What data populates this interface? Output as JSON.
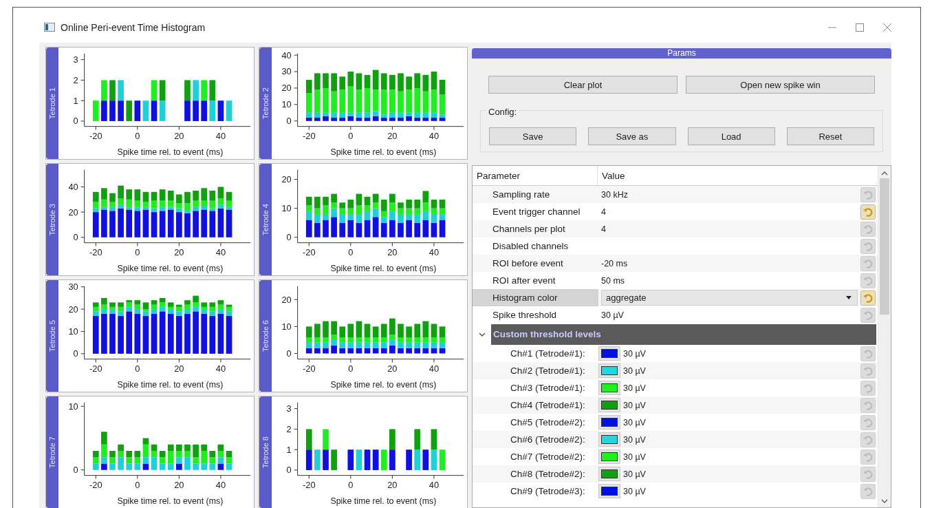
{
  "window": {
    "title": "Online Peri-event Time Histogram"
  },
  "plots": [
    {
      "chart_data": {
        "type": "bar",
        "stacked": true,
        "title": "Tetrode 1",
        "xlabel": "Spike time rel. to event (ms)",
        "x": [
          -20,
          -16,
          -12,
          -8,
          -4,
          0,
          4,
          8,
          12,
          16,
          20,
          24,
          28,
          32,
          36,
          40,
          44
        ],
        "xlim": [
          -25.5,
          54.3
        ],
        "ylim": [
          -0.26,
          3.3
        ],
        "xticks": [
          -20,
          0,
          20,
          40
        ],
        "yticks": [
          0,
          1,
          2,
          3
        ],
        "series": [
          {
            "color": "#1010e0",
            "values": [
              0,
              1,
              1,
              1,
              0,
              1,
              0,
              1,
              0,
              0,
              0,
              1,
              1,
              1,
              0,
              1,
              0
            ]
          },
          {
            "color": "#20d0d8",
            "values": [
              0,
              0,
              0,
              1,
              0,
              0,
              1,
              0,
              1,
              0,
              0,
              0,
              1,
              0,
              1,
              0,
              1
            ]
          },
          {
            "color": "#20ee20",
            "values": [
              1,
              1,
              0,
              0,
              0,
              0,
              0,
              1,
              0,
              0,
              0,
              0,
              0,
              1,
              0,
              0,
              0
            ]
          },
          {
            "color": "#10a010",
            "values": [
              0,
              0,
              1,
              0,
              1,
              0,
              0,
              0,
              1,
              0,
              0,
              1,
              0,
              0,
              1,
              0,
              0
            ]
          }
        ]
      }
    },
    {
      "chart_data": {
        "type": "bar",
        "stacked": true,
        "title": "Tetrode 2",
        "xlabel": "Spike time rel. to event (ms)",
        "x": [
          -20,
          -16,
          -12,
          -8,
          -4,
          0,
          4,
          8,
          12,
          16,
          20,
          24,
          28,
          32,
          36,
          40,
          44
        ],
        "xlim": [
          -25.5,
          54.3
        ],
        "ylim": [
          -3.3,
          41
        ],
        "xticks": [
          -20,
          0,
          20,
          40
        ],
        "yticks": [
          0,
          10,
          20,
          30,
          40
        ],
        "series": [
          {
            "color": "#1010e0",
            "values": [
              2,
              2,
              3,
              2,
              2,
              3,
              2,
              2,
              3,
              2,
              2,
              2,
              3,
              2,
              2,
              2,
              2
            ]
          },
          {
            "color": "#20d0d8",
            "values": [
              3,
              3,
              2,
              3,
              3,
              2,
              3,
              3,
              3,
              2,
              3,
              3,
              2,
              3,
              3,
              3,
              2
            ]
          },
          {
            "color": "#20ee20",
            "values": [
              12,
              14,
              15,
              13,
              14,
              16,
              14,
              15,
              13,
              15,
              14,
              13,
              14,
              15,
              13,
              14,
              12
            ]
          },
          {
            "color": "#10a010",
            "values": [
              8,
              10,
              9,
              11,
              8,
              9,
              10,
              8,
              12,
              10,
              9,
              11,
              8,
              9,
              10,
              11,
              9
            ]
          }
        ]
      }
    },
    {
      "chart_data": {
        "type": "bar",
        "stacked": true,
        "title": "Tetrode 3",
        "xlabel": "Spike time rel. to event (ms)",
        "x": [
          -20,
          -16,
          -12,
          -8,
          -4,
          0,
          4,
          8,
          12,
          16,
          20,
          24,
          28,
          32,
          36,
          40,
          44
        ],
        "xlim": [
          -25.5,
          54.3
        ],
        "ylim": [
          -4.3,
          53.5
        ],
        "xticks": [
          -20,
          0,
          20,
          40
        ],
        "yticks": [
          0,
          20,
          40
        ],
        "series": [
          {
            "color": "#1010e0",
            "values": [
              20,
              22,
              21,
              23,
              22,
              21,
              22,
              20,
              21,
              22,
              20,
              19,
              21,
              22,
              21,
              23,
              22
            ]
          },
          {
            "color": "#20d0d8",
            "values": [
              3,
              2,
              3,
              3,
              2,
              3,
              2,
              3,
              3,
              2,
              3,
              2,
              3,
              3,
              2,
              3,
              2
            ]
          },
          {
            "color": "#20ee20",
            "values": [
              5,
              6,
              4,
              5,
              6,
              5,
              4,
              6,
              5,
              5,
              4,
              6,
              5,
              4,
              6,
              5,
              5
            ]
          },
          {
            "color": "#10a010",
            "values": [
              8,
              9,
              7,
              10,
              8,
              9,
              8,
              7,
              9,
              8,
              7,
              9,
              8,
              10,
              8,
              9,
              7
            ]
          }
        ]
      }
    },
    {
      "chart_data": {
        "type": "bar",
        "stacked": true,
        "title": "Tetrode 4",
        "xlabel": "Spike time rel. to event (ms)",
        "x": [
          -20,
          -16,
          -12,
          -8,
          -4,
          0,
          4,
          8,
          12,
          16,
          20,
          24,
          28,
          32,
          36,
          40,
          44
        ],
        "xlim": [
          -25.5,
          54.3
        ],
        "ylim": [
          -1.9,
          23.3
        ],
        "xticks": [
          -20,
          0,
          20,
          40
        ],
        "yticks": [
          0,
          10,
          20
        ],
        "series": [
          {
            "color": "#1010e0",
            "values": [
              6,
              5,
              6,
              7,
              5,
              6,
              5,
              6,
              7,
              5,
              6,
              5,
              6,
              5,
              6,
              5,
              6
            ]
          },
          {
            "color": "#20d0d8",
            "values": [
              3,
              3,
              2,
              3,
              3,
              2,
              3,
              3,
              3,
              2,
              3,
              3,
              2,
              3,
              3,
              3,
              2
            ]
          },
          {
            "color": "#20ee20",
            "values": [
              2,
              2,
              3,
              2,
              2,
              2,
              3,
              2,
              2,
              2,
              3,
              2,
              2,
              2,
              3,
              2,
              2
            ]
          },
          {
            "color": "#10a010",
            "values": [
              3,
              4,
              3,
              3,
              2,
              3,
              4,
              3,
              3,
              4,
              3,
              2,
              3,
              3,
              4,
              3,
              3
            ]
          }
        ]
      }
    },
    {
      "chart_data": {
        "type": "bar",
        "stacked": true,
        "title": "Tetrode 5",
        "xlabel": "Spike time rel. to event (ms)",
        "x": [
          -20,
          -16,
          -12,
          -8,
          -4,
          0,
          4,
          8,
          12,
          16,
          20,
          24,
          28,
          32,
          36,
          40,
          44
        ],
        "xlim": [
          -25.5,
          54.3
        ],
        "ylim": [
          -2.4,
          30.3
        ],
        "xticks": [
          -20,
          0,
          20,
          40
        ],
        "yticks": [
          0,
          10,
          20,
          30
        ],
        "series": [
          {
            "color": "#1010e0",
            "values": [
              17,
              18,
              18,
              17,
              19,
              18,
              17,
              18,
              19,
              18,
              17,
              18,
              19,
              18,
              17,
              18,
              17
            ]
          },
          {
            "color": "#20d0d8",
            "values": [
              2,
              2,
              2,
              2,
              2,
              2,
              2,
              2,
              2,
              2,
              2,
              2,
              2,
              2,
              2,
              2,
              2
            ]
          },
          {
            "color": "#20ee20",
            "values": [
              2,
              2,
              1,
              2,
              2,
              2,
              1,
              2,
              2,
              1,
              2,
              2,
              2,
              1,
              2,
              2,
              2
            ]
          },
          {
            "color": "#10a010",
            "values": [
              2,
              3,
              2,
              2,
              1,
              2,
              3,
              2,
              2,
              2,
              1,
              2,
              3,
              2,
              2,
              2,
              1
            ]
          }
        ]
      }
    },
    {
      "chart_data": {
        "type": "bar",
        "stacked": true,
        "title": "Tetrode 6",
        "xlabel": "Spike time rel. to event (ms)",
        "x": [
          -20,
          -16,
          -12,
          -8,
          -4,
          0,
          4,
          8,
          12,
          16,
          20,
          24,
          28,
          32,
          36,
          40,
          44
        ],
        "xlim": [
          -25.5,
          54.3
        ],
        "ylim": [
          -2.1,
          25
        ],
        "xticks": [
          -20,
          0,
          20,
          40
        ],
        "yticks": [
          0,
          10,
          20
        ],
        "series": [
          {
            "color": "#1010e0",
            "values": [
              2,
              2,
              2,
              3,
              2,
              2,
              2,
              2,
              2,
              2,
              3,
              2,
              2,
              2,
              2,
              2,
              2
            ]
          },
          {
            "color": "#20d0d8",
            "values": [
              2,
              2,
              2,
              2,
              2,
              2,
              2,
              2,
              2,
              2,
              2,
              2,
              2,
              2,
              2,
              2,
              2
            ]
          },
          {
            "color": "#20ee20",
            "values": [
              2,
              2,
              2,
              2,
              2,
              2,
              2,
              2,
              2,
              2,
              2,
              2,
              2,
              2,
              2,
              2,
              2
            ]
          },
          {
            "color": "#10a010",
            "values": [
              4,
              5,
              6,
              5,
              4,
              5,
              6,
              5,
              4,
              5,
              6,
              5,
              4,
              5,
              6,
              5,
              4
            ]
          }
        ]
      }
    },
    {
      "chart_data": {
        "type": "bar",
        "stacked": true,
        "title": "Tetrode 7",
        "xlabel": "Spike time rel. to event (ms)",
        "x": [
          -20,
          -16,
          -12,
          -8,
          -4,
          0,
          4,
          8,
          12,
          16,
          20,
          24,
          28,
          32,
          36,
          40,
          44
        ],
        "xlim": [
          -25.5,
          54.3
        ],
        "ylim": [
          -0.86,
          10.6
        ],
        "xticks": [
          -20,
          0,
          20,
          40
        ],
        "yticks": [
          0,
          10
        ],
        "series": [
          {
            "color": "#1010e0",
            "values": [
              0,
              1,
              0,
              0,
              0,
              0,
              1,
              0,
              0,
              0,
              1,
              0,
              0,
              0,
              0,
              1,
              0
            ]
          },
          {
            "color": "#20d0d8",
            "values": [
              1,
              1,
              1,
              2,
              1,
              1,
              1,
              2,
              1,
              1,
              1,
              2,
              1,
              1,
              1,
              1,
              1
            ]
          },
          {
            "color": "#20ee20",
            "values": [
              1,
              2,
              1,
              1,
              1,
              1,
              2,
              1,
              1,
              2,
              1,
              1,
              1,
              2,
              1,
              1,
              1
            ]
          },
          {
            "color": "#10a010",
            "values": [
              1,
              2,
              1,
              1,
              1,
              1,
              1,
              1,
              1,
              1,
              1,
              1,
              2,
              1,
              1,
              1,
              1
            ]
          }
        ]
      }
    },
    {
      "chart_data": {
        "type": "bar",
        "stacked": true,
        "title": "Tetrode 8",
        "xlabel": "Spike time rel. to event (ms)",
        "x": [
          -20,
          -16,
          -12,
          -8,
          -4,
          0,
          4,
          8,
          12,
          16,
          20,
          24,
          28,
          32,
          36,
          40,
          44
        ],
        "xlim": [
          -25.5,
          54.3
        ],
        "ylim": [
          -0.26,
          3.3
        ],
        "xticks": [
          -20,
          0,
          20,
          40
        ],
        "yticks": [
          0,
          1,
          2,
          3
        ],
        "series": [
          {
            "color": "#1010e0",
            "values": [
              1,
              0,
              1,
              0,
              0,
              1,
              0,
              1,
              1,
              0,
              1,
              0,
              1,
              0,
              1,
              0,
              0
            ]
          },
          {
            "color": "#20d0d8",
            "values": [
              0,
              1,
              0,
              0,
              0,
              0,
              1,
              0,
              0,
              0,
              0,
              0,
              0,
              1,
              0,
              1,
              0
            ]
          },
          {
            "color": "#20ee20",
            "values": [
              0,
              0,
              1,
              0,
              0,
              0,
              0,
              0,
              0,
              1,
              0,
              0,
              0,
              0,
              0,
              0,
              1
            ]
          },
          {
            "color": "#10a010",
            "values": [
              1,
              0,
              0,
              1,
              0,
              0,
              0,
              0,
              0,
              0,
              1,
              0,
              0,
              1,
              0,
              1,
              0
            ]
          }
        ]
      }
    }
  ],
  "params": {
    "title": "Params",
    "buttons": [
      "Clear plot",
      "Open new spike win"
    ],
    "config": {
      "label": "Config:",
      "buttons": [
        "Save",
        "Save as",
        "Load",
        "Reset"
      ]
    },
    "table": {
      "columns": [
        "Parameter",
        "Value"
      ],
      "rows": [
        {
          "kind": "text",
          "name": "Sampling rate",
          "value": "30 kHz",
          "modified": false,
          "selected": false
        },
        {
          "kind": "text",
          "name": "Event trigger channel",
          "value": "4",
          "modified": true,
          "selected": false
        },
        {
          "kind": "text",
          "name": "Channels per plot",
          "value": "4",
          "modified": false,
          "selected": false
        },
        {
          "kind": "text",
          "name": "Disabled channels",
          "modified": false,
          "selected": false
        },
        {
          "kind": "text",
          "name": "ROI before event",
          "value": "-20 ms",
          "modified": false,
          "selected": false
        },
        {
          "kind": "text",
          "name": "ROI after event",
          "value": "50 ms",
          "modified": false,
          "selected": false
        },
        {
          "kind": "dropdown",
          "name": "Histogram color",
          "value": "aggregate",
          "modified": true,
          "selected": true
        },
        {
          "kind": "text",
          "name": "Spike threshold",
          "value": "30 µV",
          "modified": false,
          "selected": false
        }
      ],
      "group": {
        "label": "Custom threshold levels",
        "expanded": true,
        "children": [
          {
            "name": "Ch#1 (Tetrode#1):",
            "color": "#0010e0",
            "value": "30 µV",
            "modified": false
          },
          {
            "name": "Ch#2 (Tetrode#1):",
            "color": "#20d8e0",
            "value": "30 µV",
            "modified": false
          },
          {
            "name": "Ch#3 (Tetrode#1):",
            "color": "#20f020",
            "value": "30 µV",
            "modified": false
          },
          {
            "name": "Ch#4 (Tetrode#1):",
            "color": "#10a010",
            "value": "30 µV",
            "modified": false
          },
          {
            "name": "Ch#5 (Tetrode#2):",
            "color": "#0010e0",
            "value": "30 µV",
            "modified": false
          },
          {
            "name": "Ch#6 (Tetrode#2):",
            "color": "#20d8e0",
            "value": "30 µV",
            "modified": false
          },
          {
            "name": "Ch#7 (Tetrode#2):",
            "color": "#20f020",
            "value": "30 µV",
            "modified": false
          },
          {
            "name": "Ch#8 (Tetrode#2):",
            "color": "#10a010",
            "value": "30 µV",
            "modified": false
          },
          {
            "name": "Ch#9 (Tetrode#3):",
            "color": "#0010e0",
            "value": "30 µV",
            "modified": false
          }
        ]
      }
    }
  }
}
